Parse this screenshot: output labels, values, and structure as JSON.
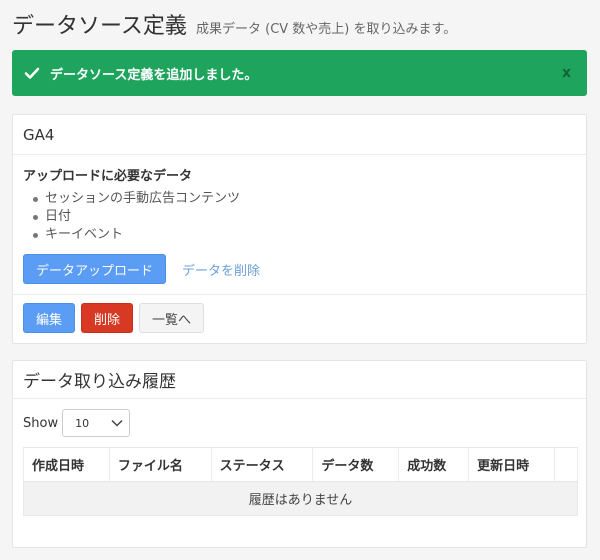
{
  "header": {
    "title": "データソース定義",
    "subtitle": "成果データ (CV 数や売上) を取り込みます。"
  },
  "alert": {
    "message": "データソース定義を追加しました。",
    "close_label": "x",
    "color": "#1fa45e"
  },
  "ga4_panel": {
    "title": "GA4",
    "required_title": "アップロードに必要なデータ",
    "required_items": [
      "セッションの手動広告コンテンツ",
      "日付",
      "キーイベント"
    ],
    "upload_label": "データアップロード",
    "delete_data_label": "データを削除",
    "edit_label": "編集",
    "delete_label": "削除",
    "list_label": "一覧へ"
  },
  "history_panel": {
    "title": "データ取り込み履歴",
    "show_label": "Show",
    "page_size": "10",
    "columns": [
      "作成日時",
      "ファイル名",
      "ステータス",
      "データ数",
      "成功数",
      "更新日時",
      ""
    ],
    "empty_message": "履歴はありません"
  },
  "icons": {
    "alert": "check-icon",
    "select": "chevron-down-icon"
  }
}
